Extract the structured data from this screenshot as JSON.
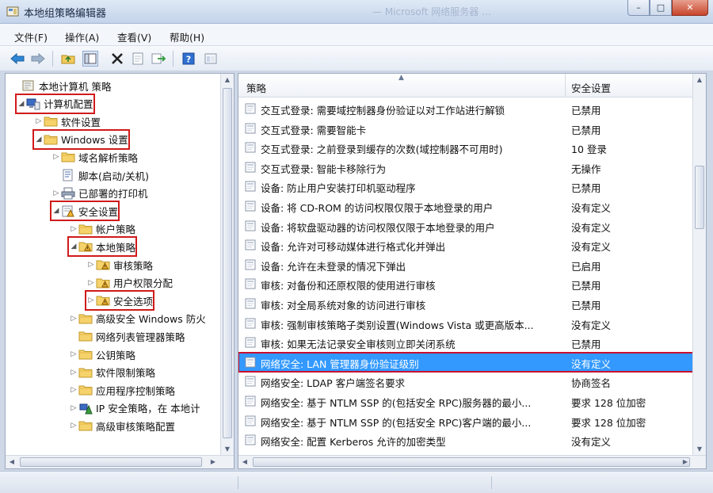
{
  "window": {
    "title": "本地组策略编辑器",
    "ghost_title": "— Microsoft 网络服务器 …",
    "buttons": {
      "minimize": "–",
      "maximize": "□",
      "close": "✕"
    }
  },
  "menu": [
    "文件(F)",
    "操作(A)",
    "查看(V)",
    "帮助(H)"
  ],
  "toolbar_icons": [
    "back-arrow-icon",
    "forward-arrow-icon",
    "up-folder-icon",
    "show-hide-tree-icon",
    "delete-x-icon",
    "properties-icon",
    "export-list-icon",
    "help-icon",
    "console-icon"
  ],
  "tree": {
    "items": [
      {
        "label": "本地计算机 策略",
        "arrow": "",
        "icon": "computer-policy-icon",
        "highlight": false
      },
      {
        "label": "计算机配置",
        "arrow": "◢",
        "icon": "computer-config-icon",
        "highlight": true
      },
      {
        "label": "软件设置",
        "arrow": "▷",
        "icon": "folder-icon",
        "highlight": false
      },
      {
        "label": "Windows 设置",
        "arrow": "◢",
        "icon": "folder-icon",
        "highlight": true
      },
      {
        "label": "域名解析策略",
        "arrow": "▷",
        "icon": "folder-icon",
        "highlight": false
      },
      {
        "label": "脚本(启动/关机)",
        "arrow": "",
        "icon": "script-icon",
        "highlight": false
      },
      {
        "label": "已部署的打印机",
        "arrow": "▷",
        "icon": "printer-icon",
        "highlight": false
      },
      {
        "label": "安全设置",
        "arrow": "◢",
        "icon": "security-settings-icon",
        "highlight": true
      },
      {
        "label": "帐户策略",
        "arrow": "▷",
        "icon": "folder-icon",
        "highlight": false
      },
      {
        "label": "本地策略",
        "arrow": "◢",
        "icon": "folder-lock-icon",
        "highlight": true
      },
      {
        "label": "审核策略",
        "arrow": "▷",
        "icon": "folder-lock-icon",
        "highlight": false
      },
      {
        "label": "用户权限分配",
        "arrow": "▷",
        "icon": "folder-lock-icon",
        "highlight": false
      },
      {
        "label": "安全选项",
        "arrow": "▷",
        "icon": "folder-lock-icon",
        "highlight": true
      },
      {
        "label": "高级安全 Windows 防火",
        "arrow": "▷",
        "icon": "folder-icon",
        "highlight": false
      },
      {
        "label": "网络列表管理器策略",
        "arrow": "",
        "icon": "folder-icon",
        "highlight": false
      },
      {
        "label": "公钥策略",
        "arrow": "▷",
        "icon": "folder-icon",
        "highlight": false
      },
      {
        "label": "软件限制策略",
        "arrow": "▷",
        "icon": "folder-icon",
        "highlight": false
      },
      {
        "label": "应用程序控制策略",
        "arrow": "▷",
        "icon": "folder-icon",
        "highlight": false
      },
      {
        "label": "IP 安全策略，在 本地计",
        "arrow": "▷",
        "icon": "ip-security-icon",
        "highlight": false
      },
      {
        "label": "高级审核策略配置",
        "arrow": "▷",
        "icon": "folder-icon",
        "highlight": false
      }
    ]
  },
  "list": {
    "columns": {
      "policy": "策略",
      "setting": "安全设置"
    },
    "rows": [
      {
        "policy": "交互式登录: 需要域控制器身份验证以对工作站进行解锁",
        "setting": "已禁用"
      },
      {
        "policy": "交互式登录: 需要智能卡",
        "setting": "已禁用"
      },
      {
        "policy": "交互式登录: 之前登录到缓存的次数(域控制器不可用时)",
        "setting": "10 登录"
      },
      {
        "policy": "交互式登录: 智能卡移除行为",
        "setting": "无操作"
      },
      {
        "policy": "设备: 防止用户安装打印机驱动程序",
        "setting": "已禁用"
      },
      {
        "policy": "设备: 将 CD-ROM 的访问权限仅限于本地登录的用户",
        "setting": "没有定义"
      },
      {
        "policy": "设备: 将软盘驱动器的访问权限仅限于本地登录的用户",
        "setting": "没有定义"
      },
      {
        "policy": "设备: 允许对可移动媒体进行格式化并弹出",
        "setting": "没有定义"
      },
      {
        "policy": "设备: 允许在未登录的情况下弹出",
        "setting": "已启用"
      },
      {
        "policy": "审核: 对备份和还原权限的使用进行审核",
        "setting": "已禁用"
      },
      {
        "policy": "审核: 对全局系统对象的访问进行审核",
        "setting": "已禁用"
      },
      {
        "policy": "审核: 强制审核策略子类别设置(Windows Vista 或更高版本...",
        "setting": "没有定义"
      },
      {
        "policy": "审核: 如果无法记录安全审核则立即关闭系统",
        "setting": "已禁用"
      },
      {
        "policy": "网络安全: LAN 管理器身份验证级别",
        "setting": "没有定义",
        "selected": true
      },
      {
        "policy": "网络安全: LDAP 客户端签名要求",
        "setting": "协商签名"
      },
      {
        "policy": "网络安全: 基于 NTLM SSP 的(包括安全 RPC)服务器的最小...",
        "setting": "要求 128 位加密"
      },
      {
        "policy": "网络安全: 基于 NTLM SSP 的(包括安全 RPC)客户端的最小...",
        "setting": "要求 128 位加密"
      },
      {
        "policy": "网络安全: 配置 Kerberos 允许的加密类型",
        "setting": "没有定义"
      }
    ]
  }
}
